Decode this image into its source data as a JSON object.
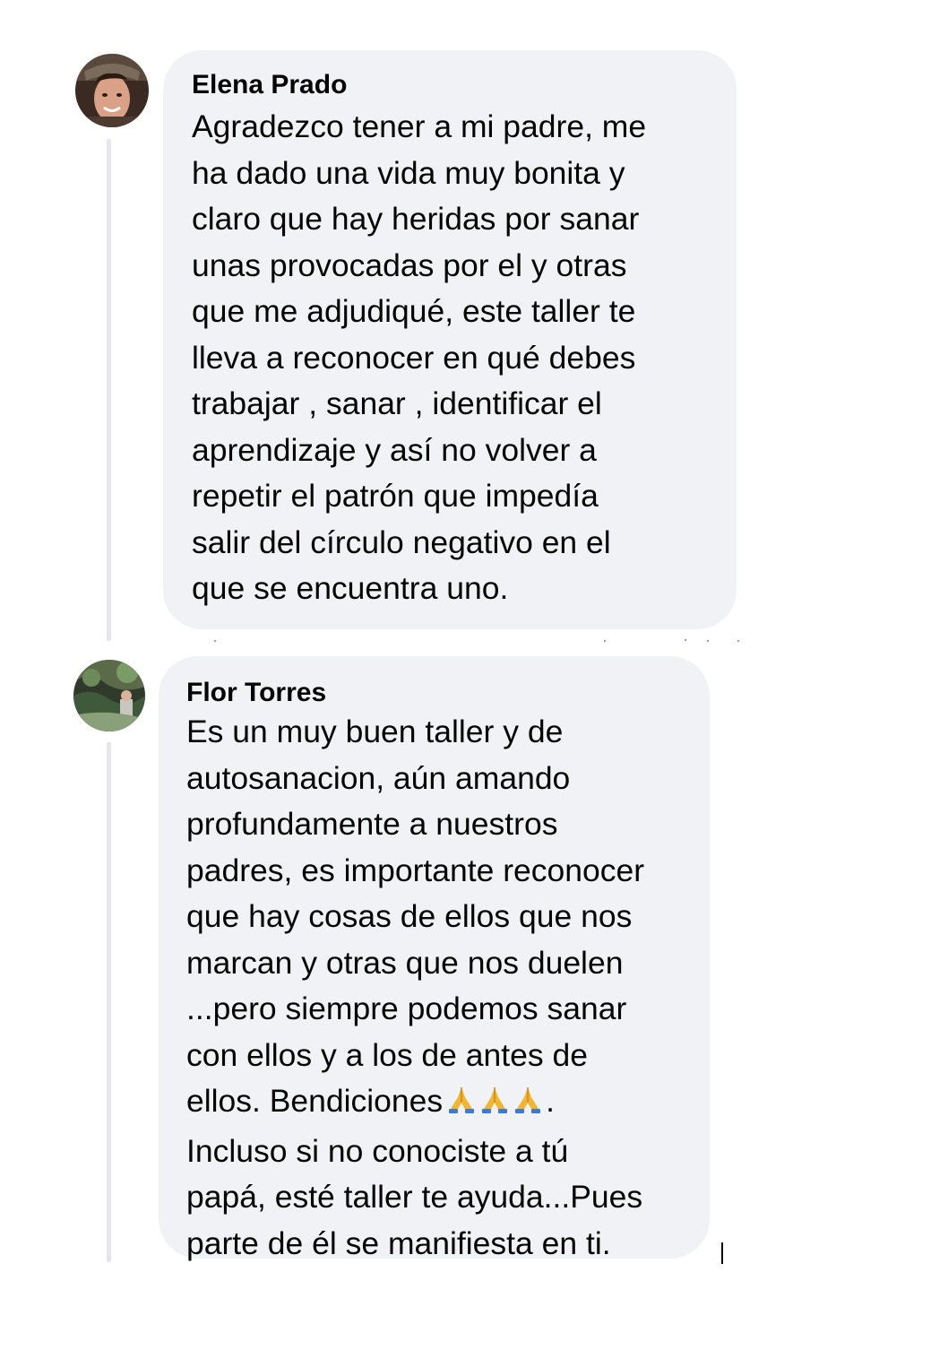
{
  "comments": [
    {
      "author": "Elena Prado",
      "avatar_icon": "profile-photo-icon",
      "text_before_emoji": "Agradezco tener a mi padre, me\nha dado una vida muy bonita y\nclaro que hay heridas por sanar\nunas provocadas por el y otras\nque me adjudiqué, este taller te\nlleva a reconocer en qué debes\ntrabajar , sanar , identificar el\naprendizaje y así no volver a\nrepetir el patrón que impedía\nsalir del círculo negativo en el\nque se encuentra uno."
    },
    {
      "author": "Flor Torres",
      "avatar_icon": "profile-photo-icon",
      "text_before_emoji": "Es un muy buen taller y de\nautosanacion, aún amando\nprofundamente a nuestros\npadres, es importante reconocer\nque hay cosas de ellos que nos\nmarcan y otras que nos duelen\n...pero siempre podemos sanar\ncon ellos y a los de antes de\nellos. Bendiciones",
      "emoji_icon": "praying-hands-icon",
      "emoji_count": 3,
      "text_after_emoji": ".",
      "text_continued": "Incluso si no conociste a tú\npapá, esté taller te ayuda...Pues\nparte de él se manifiesta en ti."
    }
  ],
  "colors": {
    "bubble_bg": "#f0f2f5",
    "thread_line": "#e4e6eb",
    "text": "#050505"
  }
}
